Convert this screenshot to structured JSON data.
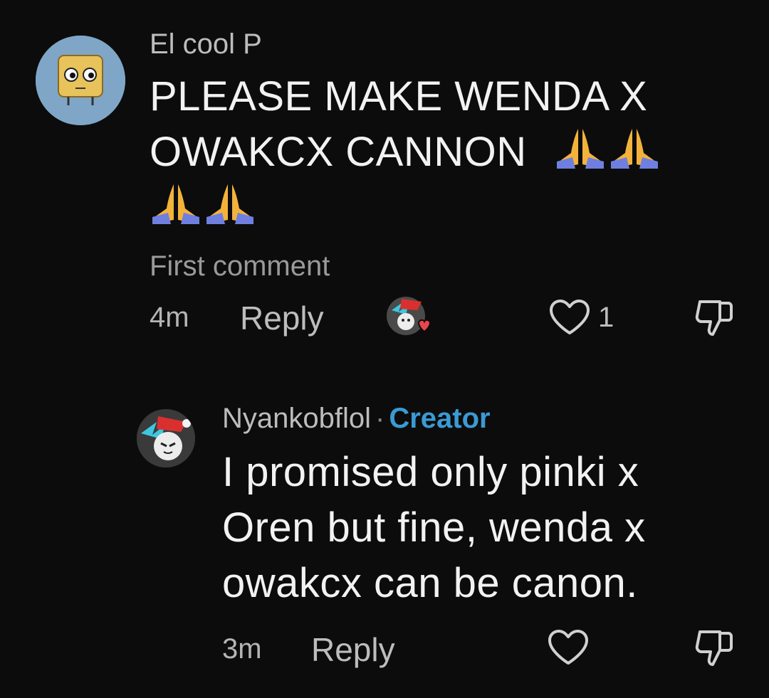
{
  "comment": {
    "username": "El cool P",
    "text_line1": "PLEASE MAKE WENDA X",
    "text_line2": "OWAKCX CANNON",
    "emoji_icon": "folded-hands-icon",
    "meta": "First comment",
    "time": "4m",
    "reply_label": "Reply",
    "like_count": "1"
  },
  "reply": {
    "username": "Nyankobflol",
    "separator": "·",
    "badge": "Creator",
    "text_line1": "I promised only pinki x",
    "text_line2": "Oren but fine, wenda x",
    "text_line3": "owakcx can be canon.",
    "time": "3m",
    "reply_label": "Reply"
  },
  "colors": {
    "background": "#0c0c0c",
    "creator_badge": "#3a9ad4",
    "heart_red": "#e8454f"
  }
}
